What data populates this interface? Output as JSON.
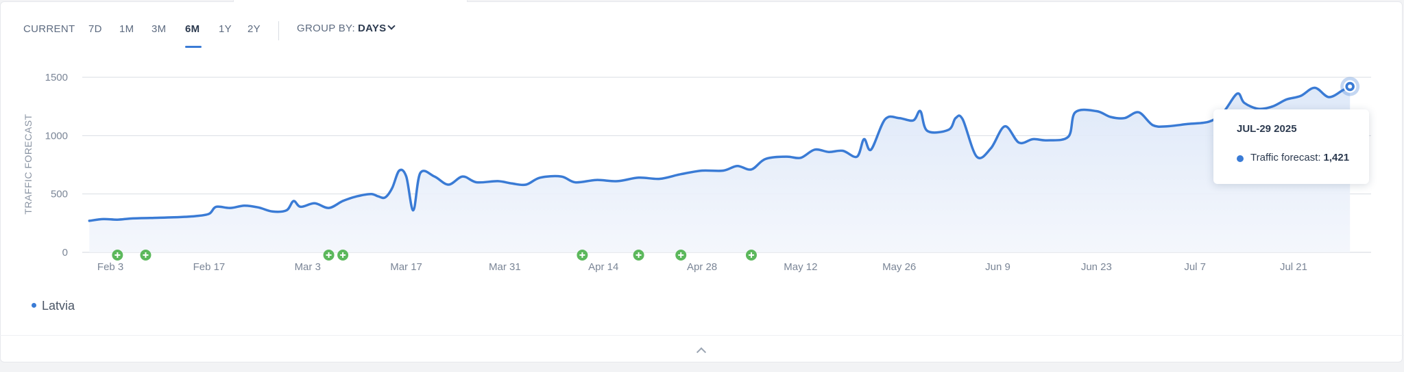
{
  "toolbar": {
    "ranges": [
      "CURRENT",
      "7D",
      "1M",
      "3M",
      "6M",
      "1Y",
      "2Y"
    ],
    "active_range": "6M",
    "group_by_label": "GROUP BY:",
    "group_by_value": "DAYS"
  },
  "colors": {
    "line": "#3a7bd5",
    "area_fill": "#e8effa",
    "event_marker": "#5cb85c",
    "grid": "#d9dde3"
  },
  "chart_data": {
    "type": "area",
    "ylabel": "TRAFFIC FORECAST",
    "ylim": [
      0,
      1500
    ],
    "yticks": [
      0,
      500,
      1000,
      1500
    ],
    "xlim": [
      "2025-01-30",
      "2025-08-01"
    ],
    "xticks": [
      {
        "date": "2025-02-03",
        "label": "Feb 3"
      },
      {
        "date": "2025-02-17",
        "label": "Feb 17"
      },
      {
        "date": "2025-03-03",
        "label": "Mar 3"
      },
      {
        "date": "2025-03-17",
        "label": "Mar 17"
      },
      {
        "date": "2025-03-31",
        "label": "Mar 31"
      },
      {
        "date": "2025-04-14",
        "label": "Apr 14"
      },
      {
        "date": "2025-04-28",
        "label": "Apr 28"
      },
      {
        "date": "2025-05-12",
        "label": "May 12"
      },
      {
        "date": "2025-05-26",
        "label": "May 26"
      },
      {
        "date": "2025-06-09",
        "label": "Jun 9"
      },
      {
        "date": "2025-06-23",
        "label": "Jun 23"
      },
      {
        "date": "2025-07-07",
        "label": "Jul 7"
      },
      {
        "date": "2025-07-21",
        "label": "Jul 21"
      }
    ],
    "grid": true,
    "series": [
      {
        "name": "Latvia",
        "points": [
          [
            "2025-01-31",
            270
          ],
          [
            "2025-02-02",
            285
          ],
          [
            "2025-02-04",
            280
          ],
          [
            "2025-02-06",
            290
          ],
          [
            "2025-02-09",
            295
          ],
          [
            "2025-02-12",
            300
          ],
          [
            "2025-02-15",
            310
          ],
          [
            "2025-02-17",
            330
          ],
          [
            "2025-02-18",
            390
          ],
          [
            "2025-02-20",
            380
          ],
          [
            "2025-02-22",
            400
          ],
          [
            "2025-02-24",
            385
          ],
          [
            "2025-02-26",
            350
          ],
          [
            "2025-02-28",
            360
          ],
          [
            "2025-03-01",
            440
          ],
          [
            "2025-03-02",
            390
          ],
          [
            "2025-03-04",
            420
          ],
          [
            "2025-03-06",
            380
          ],
          [
            "2025-03-08",
            440
          ],
          [
            "2025-03-10",
            480
          ],
          [
            "2025-03-12",
            500
          ],
          [
            "2025-03-13",
            480
          ],
          [
            "2025-03-14",
            470
          ],
          [
            "2025-03-15",
            550
          ],
          [
            "2025-03-16",
            700
          ],
          [
            "2025-03-17",
            650
          ],
          [
            "2025-03-18",
            360
          ],
          [
            "2025-03-19",
            680
          ],
          [
            "2025-03-21",
            650
          ],
          [
            "2025-03-23",
            580
          ],
          [
            "2025-03-25",
            650
          ],
          [
            "2025-03-27",
            600
          ],
          [
            "2025-03-30",
            610
          ],
          [
            "2025-04-01",
            590
          ],
          [
            "2025-04-03",
            580
          ],
          [
            "2025-04-05",
            640
          ],
          [
            "2025-04-08",
            650
          ],
          [
            "2025-04-10",
            600
          ],
          [
            "2025-04-13",
            620
          ],
          [
            "2025-04-16",
            610
          ],
          [
            "2025-04-19",
            640
          ],
          [
            "2025-04-22",
            630
          ],
          [
            "2025-04-25",
            670
          ],
          [
            "2025-04-28",
            700
          ],
          [
            "2025-05-01",
            700
          ],
          [
            "2025-05-03",
            740
          ],
          [
            "2025-05-05",
            710
          ],
          [
            "2025-05-07",
            800
          ],
          [
            "2025-05-10",
            820
          ],
          [
            "2025-05-12",
            810
          ],
          [
            "2025-05-14",
            880
          ],
          [
            "2025-05-16",
            860
          ],
          [
            "2025-05-18",
            870
          ],
          [
            "2025-05-20",
            820
          ],
          [
            "2025-05-21",
            970
          ],
          [
            "2025-05-22",
            880
          ],
          [
            "2025-05-24",
            1140
          ],
          [
            "2025-05-26",
            1150
          ],
          [
            "2025-05-28",
            1130
          ],
          [
            "2025-05-29",
            1210
          ],
          [
            "2025-05-30",
            1040
          ],
          [
            "2025-06-02",
            1050
          ],
          [
            "2025-06-03",
            1150
          ],
          [
            "2025-06-04",
            1140
          ],
          [
            "2025-06-06",
            820
          ],
          [
            "2025-06-08",
            890
          ],
          [
            "2025-06-10",
            1080
          ],
          [
            "2025-06-12",
            940
          ],
          [
            "2025-06-14",
            970
          ],
          [
            "2025-06-16",
            960
          ],
          [
            "2025-06-19",
            990
          ],
          [
            "2025-06-20",
            1200
          ],
          [
            "2025-06-23",
            1210
          ],
          [
            "2025-06-25",
            1160
          ],
          [
            "2025-06-27",
            1150
          ],
          [
            "2025-06-29",
            1200
          ],
          [
            "2025-07-01",
            1090
          ],
          [
            "2025-07-03",
            1080
          ],
          [
            "2025-07-06",
            1100
          ],
          [
            "2025-07-09",
            1120
          ],
          [
            "2025-07-11",
            1200
          ],
          [
            "2025-07-13",
            1360
          ],
          [
            "2025-07-14",
            1280
          ],
          [
            "2025-07-16",
            1230
          ],
          [
            "2025-07-18",
            1250
          ],
          [
            "2025-07-20",
            1310
          ],
          [
            "2025-07-22",
            1340
          ],
          [
            "2025-07-24",
            1410
          ],
          [
            "2025-07-26",
            1330
          ],
          [
            "2025-07-28",
            1390
          ],
          [
            "2025-07-29",
            1421
          ]
        ]
      }
    ],
    "event_markers": [
      "2025-02-04",
      "2025-02-08",
      "2025-03-06",
      "2025-03-08",
      "2025-04-11",
      "2025-04-19",
      "2025-04-25",
      "2025-05-05"
    ],
    "highlight": {
      "date": "2025-07-29",
      "value": 1421
    }
  },
  "tooltip": {
    "date": "JUL-29 2025",
    "label": "Traffic forecast:",
    "value": "1,421"
  },
  "legend": {
    "items": [
      "Latvia"
    ]
  }
}
